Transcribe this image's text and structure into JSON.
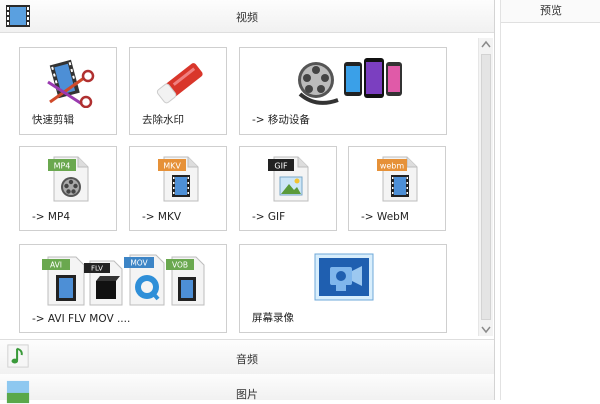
{
  "sections": {
    "video": "视频",
    "audio": "音频",
    "picture": "图片"
  },
  "preview": {
    "title": "预览"
  },
  "tiles": [
    {
      "label": "快速剪辑",
      "icon": "film-scissors-icon"
    },
    {
      "label": "去除水印",
      "icon": "eraser-icon"
    },
    {
      "label": "-> 移动设备",
      "icon": "film-reel-phones-icon"
    },
    {
      "label": "-> MP4",
      "icon": "mp4-file-icon"
    },
    {
      "label": "-> MKV",
      "icon": "mkv-file-icon"
    },
    {
      "label": "-> GIF",
      "icon": "gif-file-icon"
    },
    {
      "label": "-> WebM",
      "icon": "webm-file-icon"
    },
    {
      "label": "-> AVI FLV MOV ....",
      "icon": "multi-format-icon"
    },
    {
      "label": "屏幕录像",
      "icon": "screen-record-icon"
    }
  ],
  "badges": {
    "mp4": "MP4",
    "mkv": "MKV",
    "gif": "GIF",
    "webm": "webm",
    "avi": "AVI",
    "flv": "FLV",
    "mov": "MOV",
    "vob": "VOB"
  },
  "colors": {
    "badge_green": "#6aa84f",
    "badge_orange": "#e69138",
    "badge_black": "#222222",
    "film_blue": "#2b6cb0",
    "eraser_red": "#d9362b"
  }
}
